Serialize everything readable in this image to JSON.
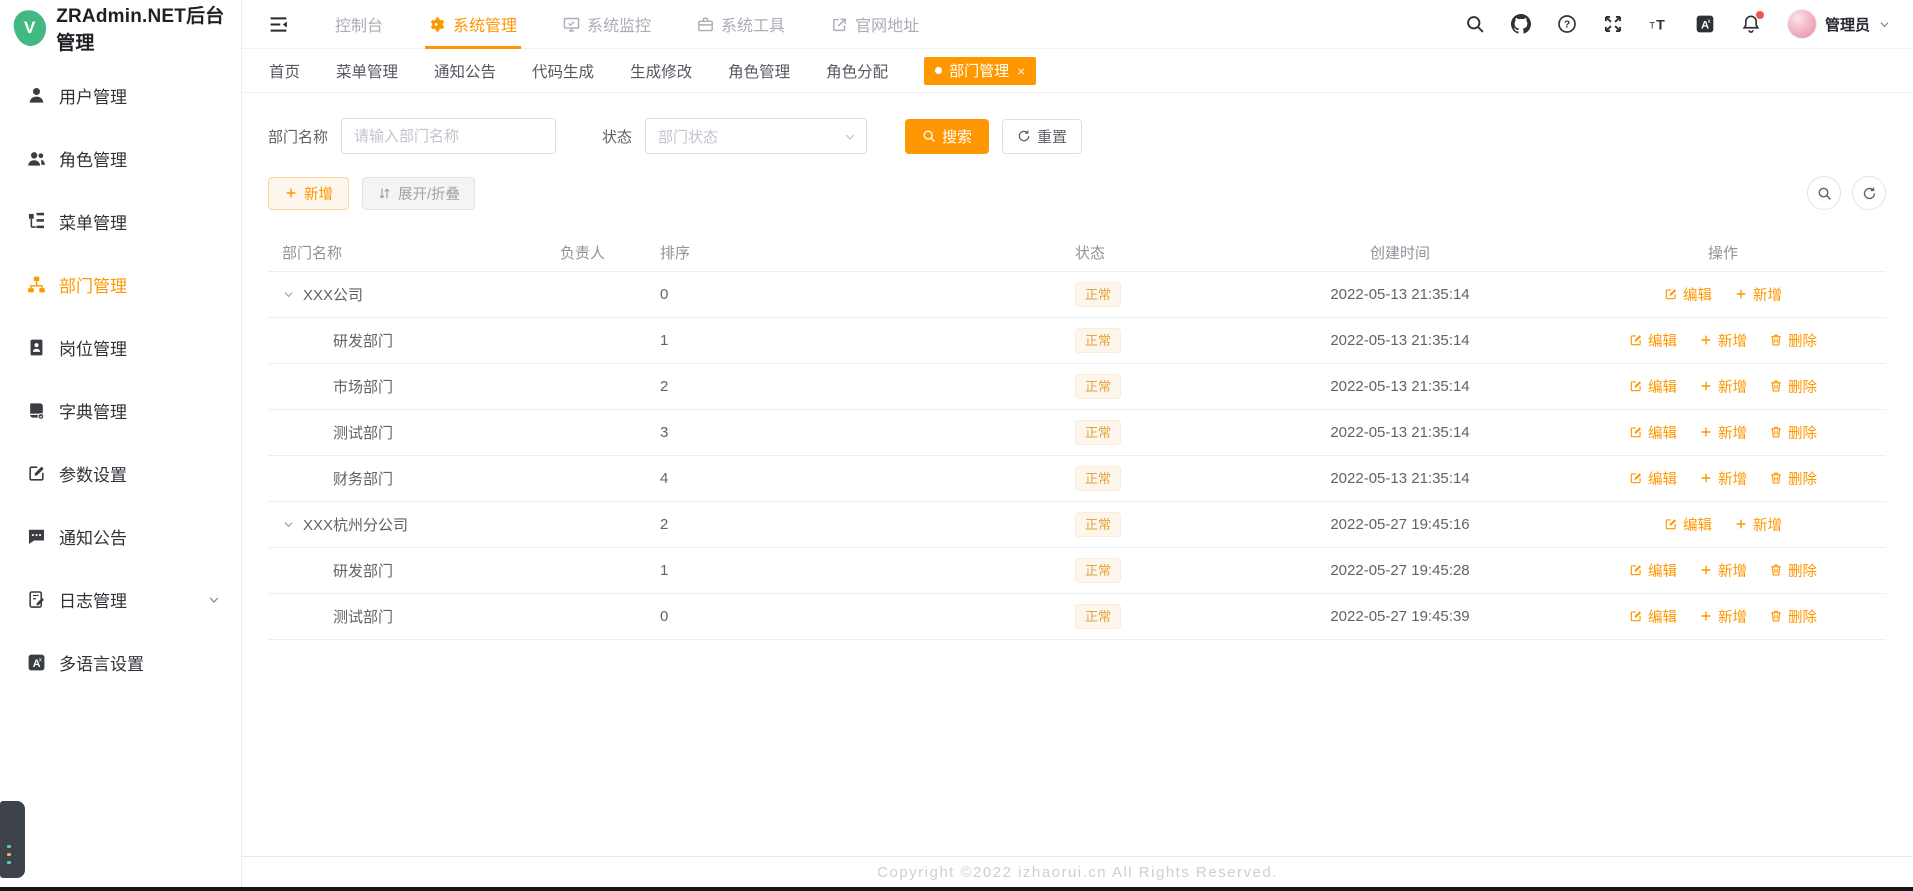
{
  "app": {
    "title": "ZRAdmin.NET后台管理",
    "logo_letter": "V"
  },
  "colors": {
    "primary": "#ff9700",
    "badge_text": "#e6a23c",
    "badge_bg": "#fdf6ec",
    "logo_green": "#42b983",
    "notification_dot": "#f25555"
  },
  "sidebar": {
    "items": [
      {
        "key": "users",
        "label": "用户管理",
        "icon": "user-icon",
        "active": false
      },
      {
        "key": "roles",
        "label": "角色管理",
        "icon": "roles-icon",
        "active": false
      },
      {
        "key": "menus",
        "label": "菜单管理",
        "icon": "menu-tree-icon",
        "active": false
      },
      {
        "key": "depts",
        "label": "部门管理",
        "icon": "org-icon",
        "active": true
      },
      {
        "key": "posts",
        "label": "岗位管理",
        "icon": "post-icon",
        "active": false
      },
      {
        "key": "dict",
        "label": "字典管理",
        "icon": "dict-icon",
        "active": false
      },
      {
        "key": "params",
        "label": "参数设置",
        "icon": "param-icon",
        "active": false
      },
      {
        "key": "notice",
        "label": "通知公告",
        "icon": "notice-icon",
        "active": false
      },
      {
        "key": "logs",
        "label": "日志管理",
        "icon": "log-icon",
        "active": false,
        "expandable": true
      },
      {
        "key": "i18n",
        "label": "多语言设置",
        "icon": "translate-icon",
        "active": false
      }
    ]
  },
  "topnav": {
    "items": [
      {
        "key": "console",
        "label": "控制台",
        "icon": null,
        "active": false
      },
      {
        "key": "system-admin",
        "label": "系统管理",
        "icon": "gear-icon",
        "active": true
      },
      {
        "key": "system-monitor",
        "label": "系统监控",
        "icon": "monitor-icon",
        "active": false
      },
      {
        "key": "system-tools",
        "label": "系统工具",
        "icon": "toolbox-icon",
        "active": false
      },
      {
        "key": "site-link",
        "label": "官网地址",
        "icon": "external-link-icon",
        "active": false
      }
    ],
    "right_icons": [
      "search-icon",
      "github-icon",
      "question-icon",
      "fullscreen-icon",
      "font-size-icon",
      "translate-icon",
      "bell-icon"
    ],
    "user_name": "管理员"
  },
  "tabs": {
    "items": [
      "首页",
      "菜单管理",
      "通知公告",
      "代码生成",
      "生成修改",
      "角色管理",
      "角色分配",
      "部门管理"
    ],
    "active": "部门管理",
    "close_glyph": "×"
  },
  "filter": {
    "dept_label": "部门名称",
    "dept_placeholder": "请输入部门名称",
    "dept_value": "",
    "status_label": "状态",
    "status_placeholder": "部门状态",
    "search_label": "搜索",
    "reset_label": "重置"
  },
  "toolbar": {
    "add_label": "新增",
    "expand_label": "展开/折叠"
  },
  "table": {
    "headers": [
      "部门名称",
      "负责人",
      "排序",
      "状态",
      "创建时间",
      "操作"
    ],
    "edit_label": "编辑",
    "add_label": "新增",
    "delete_label": "删除",
    "rows": [
      {
        "name": "XXX公司",
        "child": false,
        "toggle": true,
        "manager": "",
        "order": "0",
        "status": "正常",
        "created": "2022-05-13 21:35:14",
        "actions": [
          "edit",
          "add"
        ]
      },
      {
        "name": "研发部门",
        "child": true,
        "toggle": false,
        "manager": "",
        "order": "1",
        "status": "正常",
        "created": "2022-05-13 21:35:14",
        "actions": [
          "edit",
          "add",
          "delete"
        ]
      },
      {
        "name": "市场部门",
        "child": true,
        "toggle": false,
        "manager": "",
        "order": "2",
        "status": "正常",
        "created": "2022-05-13 21:35:14",
        "actions": [
          "edit",
          "add",
          "delete"
        ]
      },
      {
        "name": "测试部门",
        "child": true,
        "toggle": false,
        "manager": "",
        "order": "3",
        "status": "正常",
        "created": "2022-05-13 21:35:14",
        "actions": [
          "edit",
          "add",
          "delete"
        ]
      },
      {
        "name": "财务部门",
        "child": true,
        "toggle": false,
        "manager": "",
        "order": "4",
        "status": "正常",
        "created": "2022-05-13 21:35:14",
        "actions": [
          "edit",
          "add",
          "delete"
        ]
      },
      {
        "name": "XXX杭州分公司",
        "child": false,
        "toggle": true,
        "manager": "",
        "order": "2",
        "status": "正常",
        "created": "2022-05-27 19:45:16",
        "actions": [
          "edit",
          "add"
        ]
      },
      {
        "name": "研发部门",
        "child": true,
        "toggle": false,
        "manager": "",
        "order": "1",
        "status": "正常",
        "created": "2022-05-27 19:45:28",
        "actions": [
          "edit",
          "add",
          "delete"
        ]
      },
      {
        "name": "测试部门",
        "child": true,
        "toggle": false,
        "manager": "",
        "order": "0",
        "status": "正常",
        "created": "2022-05-27 19:45:39",
        "actions": [
          "edit",
          "add",
          "delete"
        ]
      }
    ]
  },
  "footer": {
    "copyright": "Copyright ©2022 izhaorui.cn All Rights Reserved."
  }
}
